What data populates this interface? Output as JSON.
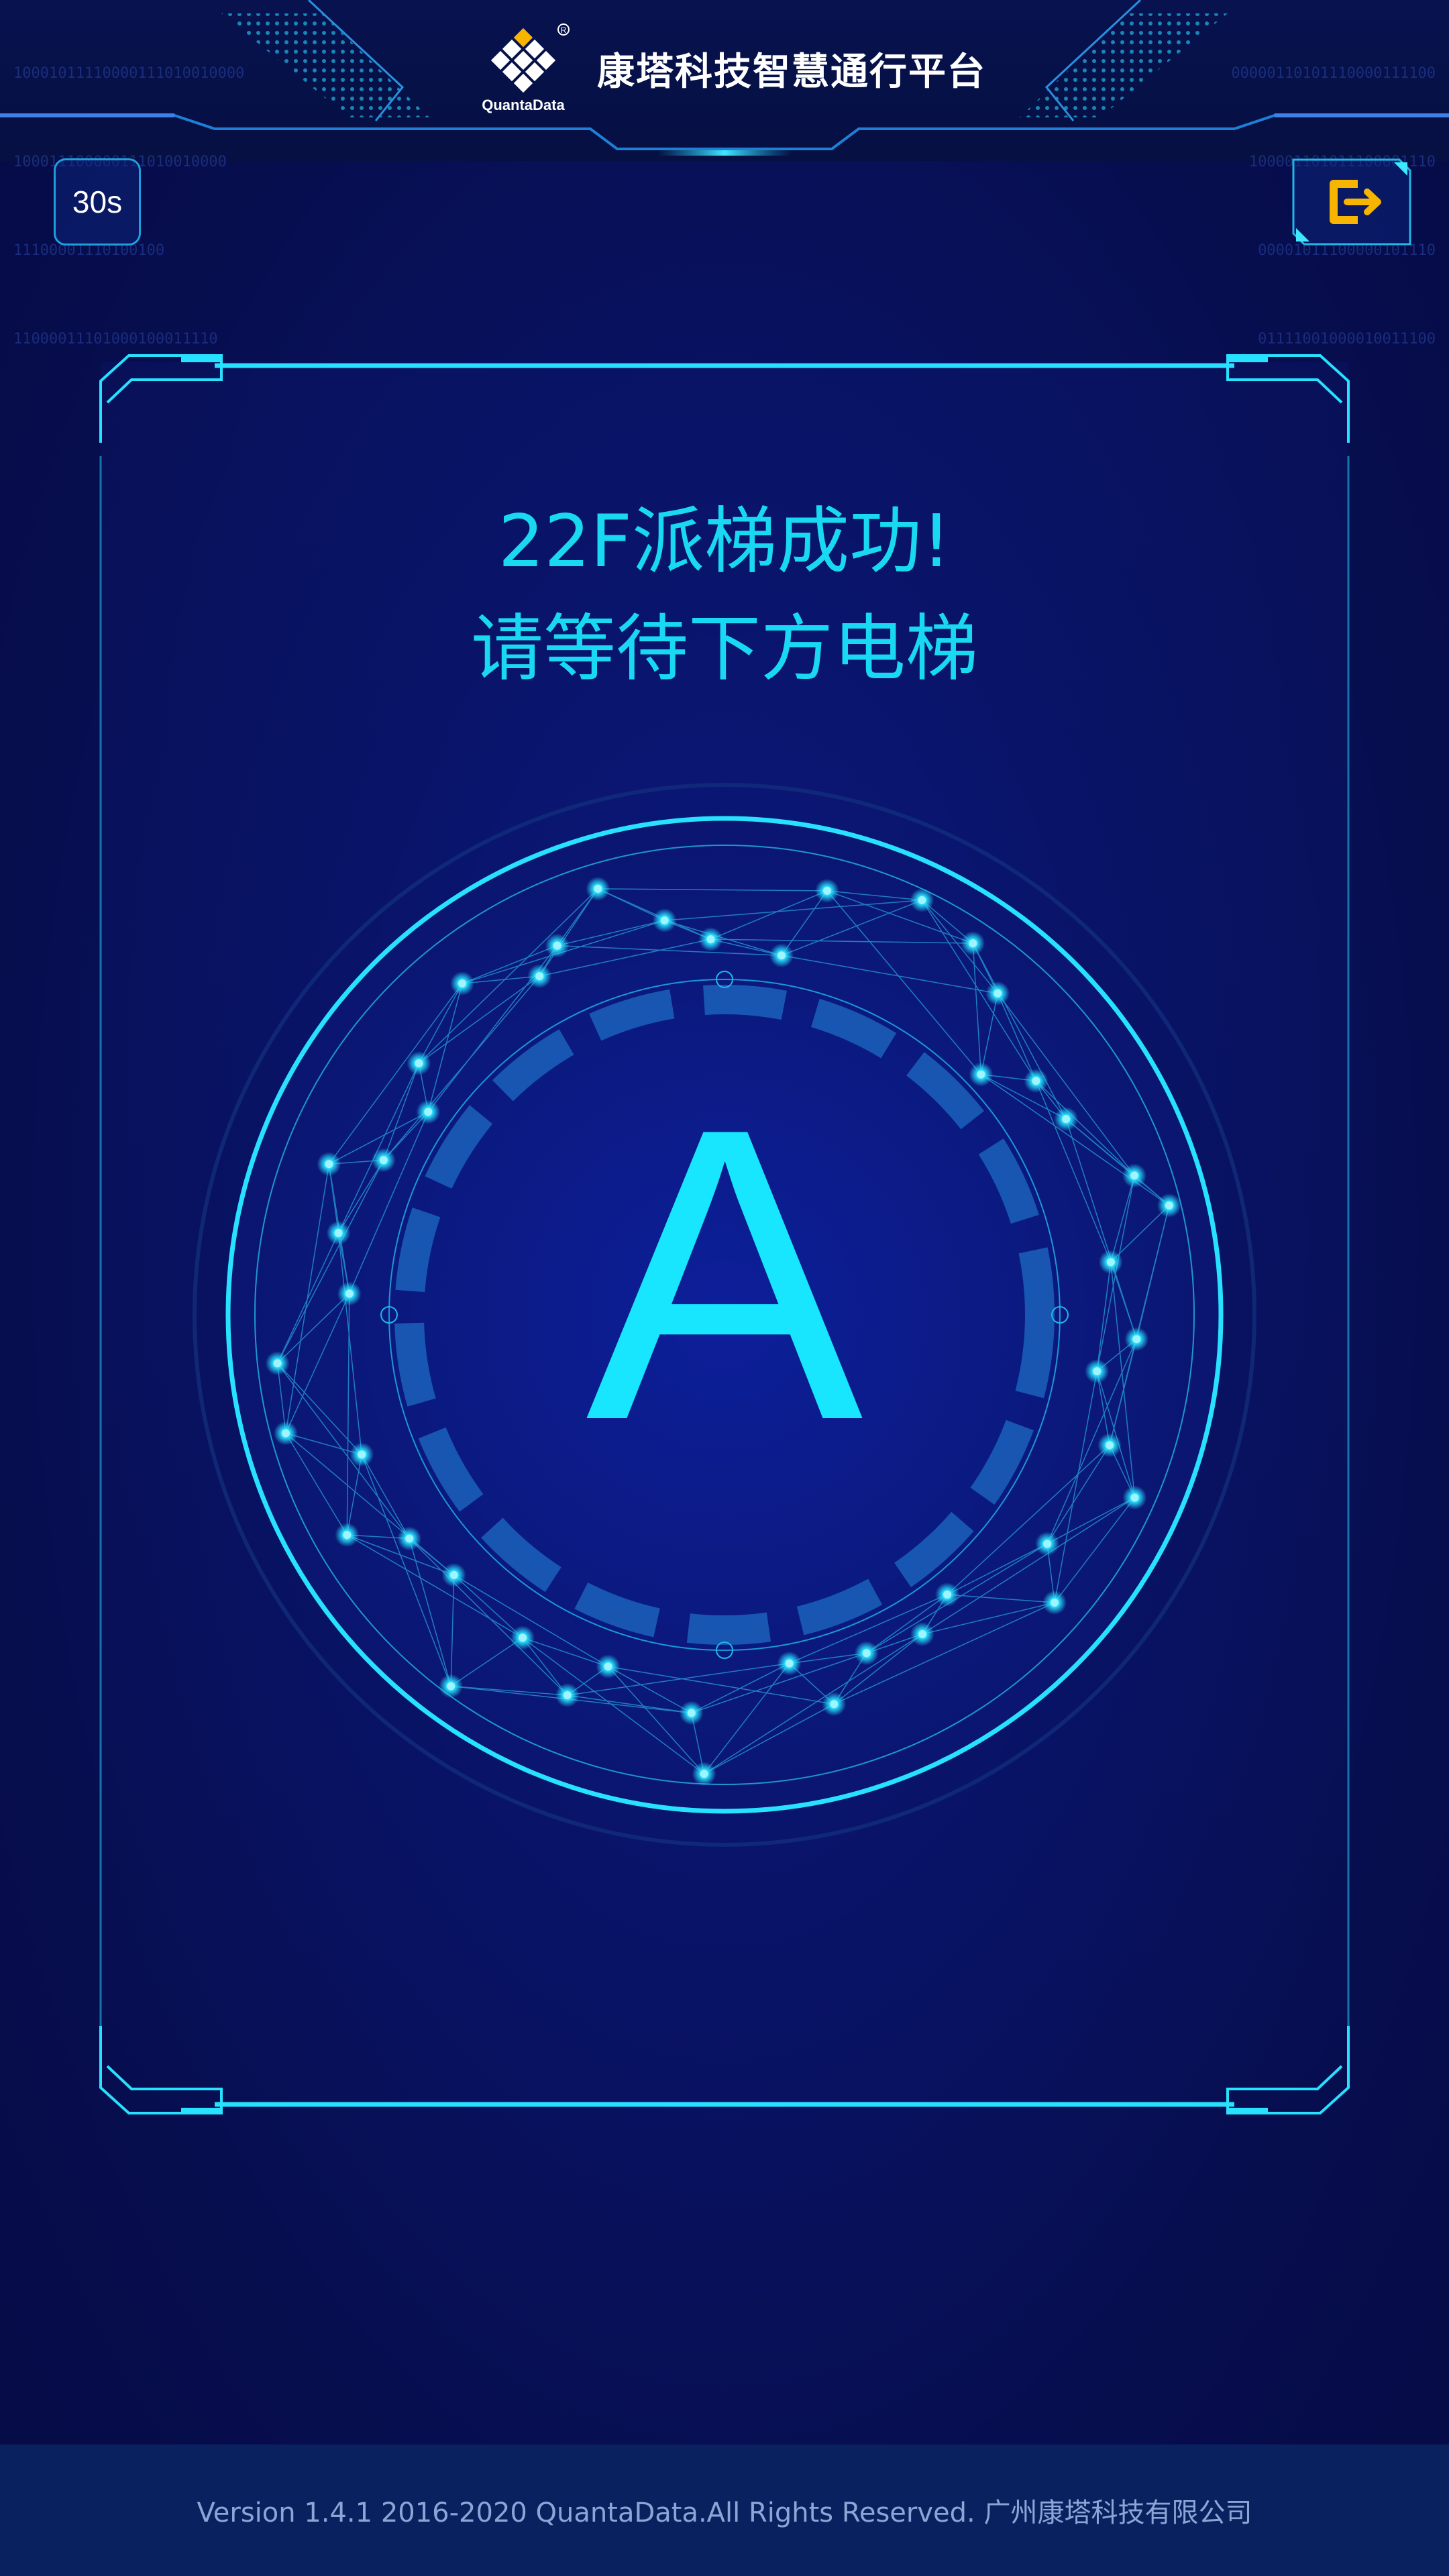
{
  "header": {
    "logo_text": "QuantaData",
    "title": "康塔科技智慧通行平台",
    "binary_left": [
      "10001011110000111010010000",
      "100011100000111010010000",
      "11100001110100100",
      "11000011101000100011110"
    ],
    "binary_right": [
      "00000110101110000111100",
      "100001101011100001110",
      "00001011100000101110",
      "01111001000010011100"
    ]
  },
  "timer": {
    "label": "30s"
  },
  "exit": {
    "icon": "exit-icon"
  },
  "message": {
    "line1": "22F派梯成功!",
    "line2": "请等待下方电梯"
  },
  "elevator": {
    "letter": "A"
  },
  "footer": {
    "text": "Version 1.4.1 2016-2020 QuantaData.All Rights Reserved. 广州康塔科技有限公司"
  },
  "colors": {
    "background": "#070e4f",
    "accent": "#18d8f2",
    "exit_icon": "#f7b500",
    "footer_bg": "#0a2160"
  }
}
